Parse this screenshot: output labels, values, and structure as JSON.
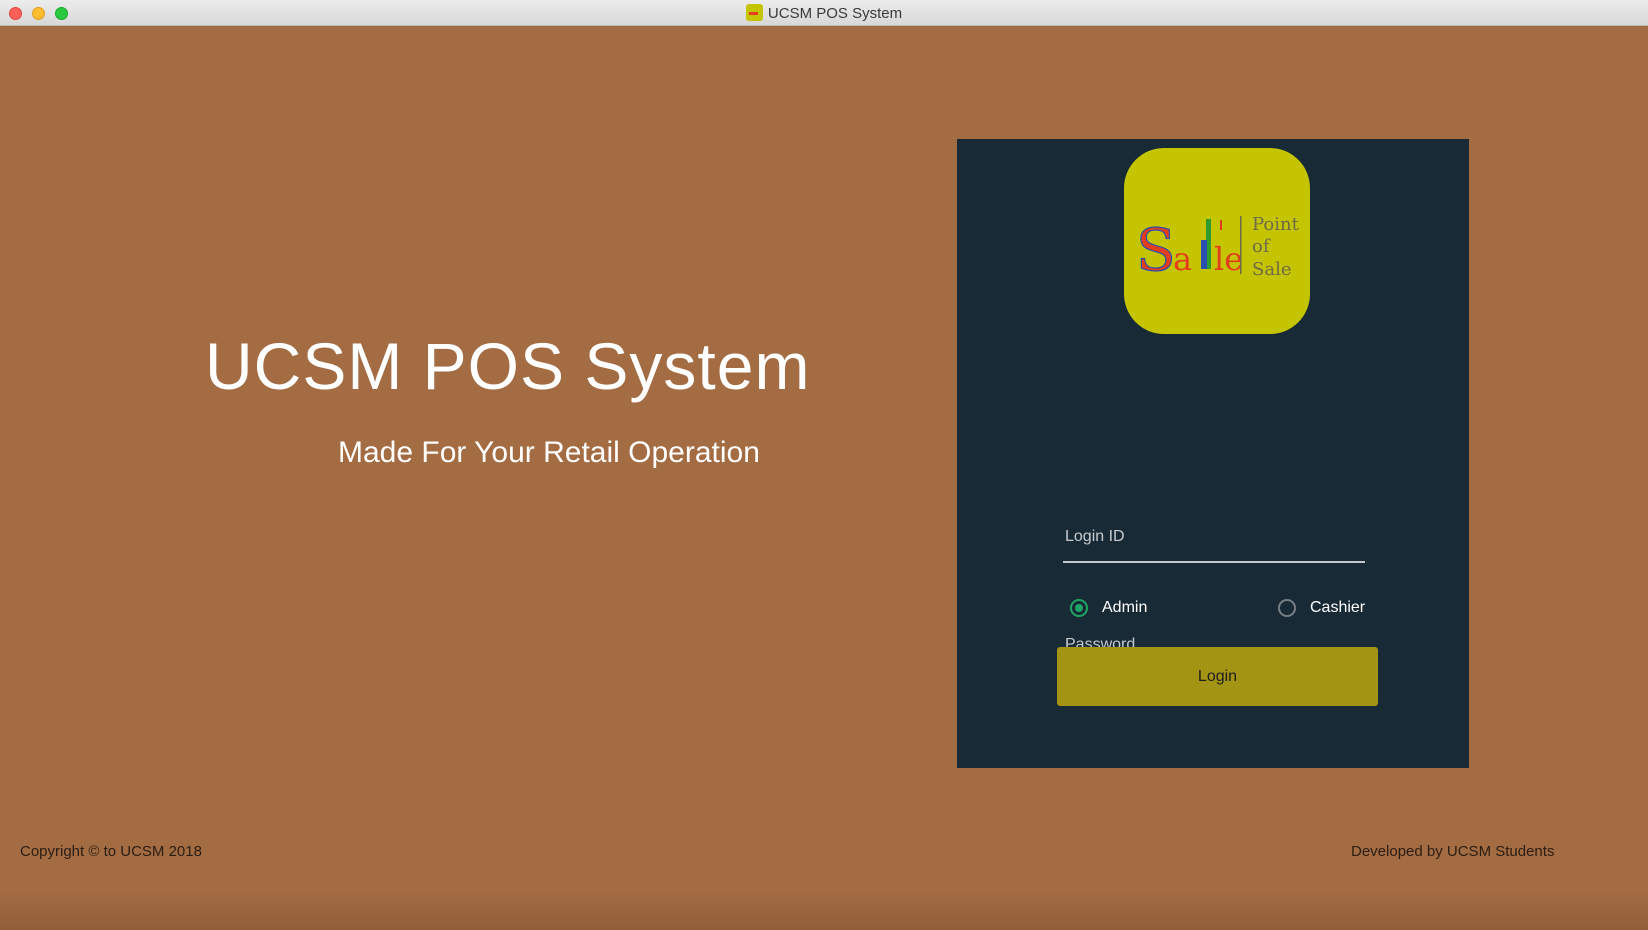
{
  "window": {
    "title": "UCSM POS System",
    "icon": "pos-app-icon"
  },
  "hero": {
    "title": "UCSM POS System",
    "subtitle": "Made For Your Retail Operation"
  },
  "logo": {
    "word": "Sale",
    "line1": "Point",
    "line2": "of",
    "line3": "Sale"
  },
  "login_form": {
    "login_id_placeholder": "Login ID",
    "login_id_value": "",
    "password_placeholder": "Password",
    "password_value": "",
    "roles": [
      {
        "label": "Admin",
        "selected": true
      },
      {
        "label": "Cashier",
        "selected": false
      }
    ],
    "submit_label": "Login"
  },
  "footer": {
    "copyright": "Copyright © to UCSM 2018",
    "credits": "Developed by UCSM Students"
  },
  "colors": {
    "background": "#a46c43",
    "panel": "#182a35",
    "logo_tile": "#c5c400",
    "button": "#a39413",
    "radio_accent": "#1fa564"
  }
}
